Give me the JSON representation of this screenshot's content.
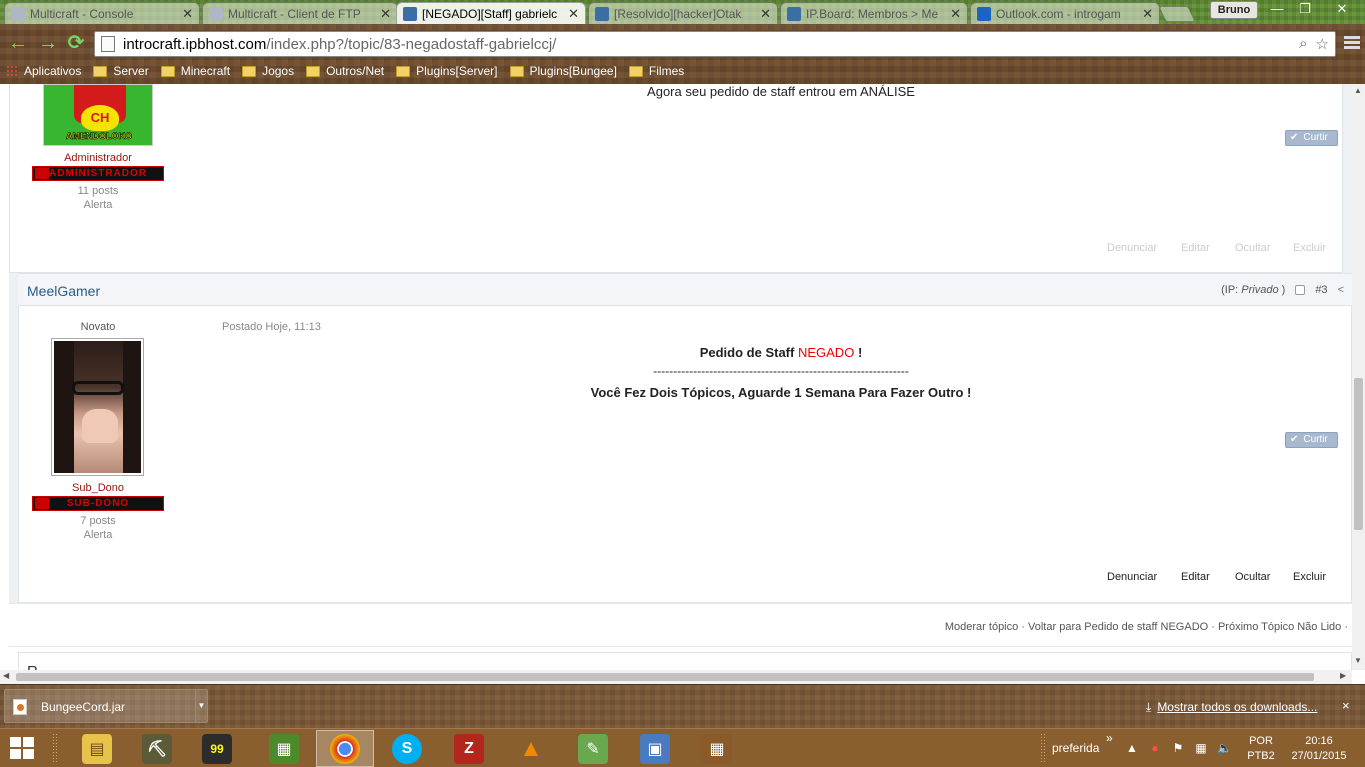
{
  "browser": {
    "tabs": [
      {
        "label": "Multicraft - Console",
        "icon_color": "#b0b6c4",
        "active": false
      },
      {
        "label": "Multicraft - Client de FTP",
        "icon_color": "#b0b6c4",
        "active": false
      },
      {
        "label": "[NEGADO][Staff] gabrielc",
        "icon_color": "#3b6ea5",
        "active": true
      },
      {
        "label": "[Resolvido][hacker]Otak",
        "icon_color": "#3b6ea5",
        "active": false
      },
      {
        "label": "IP.Board: Membros > Me",
        "icon_color": "#3b6ea5",
        "active": false
      },
      {
        "label": "Outlook.com - introgam",
        "icon_color": "#1c64c4",
        "active": false
      }
    ],
    "user_name": "Bruno",
    "url_host": "introcraft.ipbhost.com",
    "url_path": "/index.php?/topic/83-negadostaff-gabrielccj/",
    "bookmarks": [
      "Aplicativos",
      "Server",
      "Minecraft",
      "Jogos",
      "Outros/Net",
      "Plugins[Server]",
      "Plugins[Bungee]",
      "Filmes"
    ]
  },
  "page": {
    "prev_post": {
      "content": "Agora seu pedido de staff entrou em ANÁLISE",
      "avatar_caption": "AMENDOLOKO",
      "avatar_letters": "CH",
      "group": "Administrador",
      "badge": "ADMINISTRADOR",
      "posts": "11 posts",
      "alert": "Alerta",
      "like_label": "Curtir",
      "actions": {
        "report": "Denunciar",
        "edit": "Editar",
        "hide": "Ocultar",
        "delete": "Excluir"
      }
    },
    "post": {
      "author": "MeelGamer",
      "ip_label": "(IP:",
      "ip_value": "Privado",
      "ip_close": ")",
      "number": "#3",
      "rank": "Novato",
      "date": "Postado Hoje, 11:13",
      "line1_prefix": "Pedido de Staff",
      "line1_status": "NEGADO",
      "line1_suffix": "!",
      "separator": "----------------------------------------------------------------",
      "line2": "Você Fez Dois Tópicos, Aguarde 1 Semana Para Fazer Outro !",
      "group": "Sub_Dono",
      "badge": "SUB-DONO",
      "posts": "7 posts",
      "alert": "Alerta",
      "like_label": "Curtir",
      "actions": {
        "report": "Denunciar",
        "edit": "Editar",
        "hide": "Ocultar",
        "delete": "Excluir"
      }
    },
    "moderation_links": "Moderar tópico · Voltar para Pedido de staff NEGADO · Próximo Tópico Não Lido ·",
    "next_panel_title": "R"
  },
  "downloads": {
    "file": "BungeeCord.jar",
    "show_all": "Mostrar todos os downloads...",
    "close": "×"
  },
  "taskbar": {
    "apps": [
      {
        "name": "file-explorer",
        "color": "#e8c34a",
        "glyph": "▤"
      },
      {
        "name": "minecraft-launcher",
        "color": "#5b5b3a",
        "glyph": "⛏"
      },
      {
        "name": "cpu-monitor",
        "color": "#2c2c2c",
        "glyph": "99"
      },
      {
        "name": "minecraft-grass",
        "color": "#4e8a2b",
        "glyph": "▦"
      },
      {
        "name": "chrome",
        "color": "#d8d8d8",
        "glyph": "◉"
      },
      {
        "name": "skype",
        "color": "#00aff0",
        "glyph": "S"
      },
      {
        "name": "filezilla",
        "color": "#b3261e",
        "glyph": "Z"
      },
      {
        "name": "vlc",
        "color": "#f08a00",
        "glyph": "▲"
      },
      {
        "name": "notepad-plus",
        "color": "#6aa84f",
        "glyph": "✎"
      },
      {
        "name": "remote-desktop",
        "color": "#4b7bbf",
        "glyph": "▣"
      },
      {
        "name": "crafting-table",
        "color": "#8a5a2b",
        "glyph": "▦"
      }
    ],
    "tray_text": "preferida",
    "tray_expand": "»",
    "lang_line1": "POR",
    "lang_line2": "PTB2",
    "time": "20:16",
    "date": "27/01/2015"
  }
}
